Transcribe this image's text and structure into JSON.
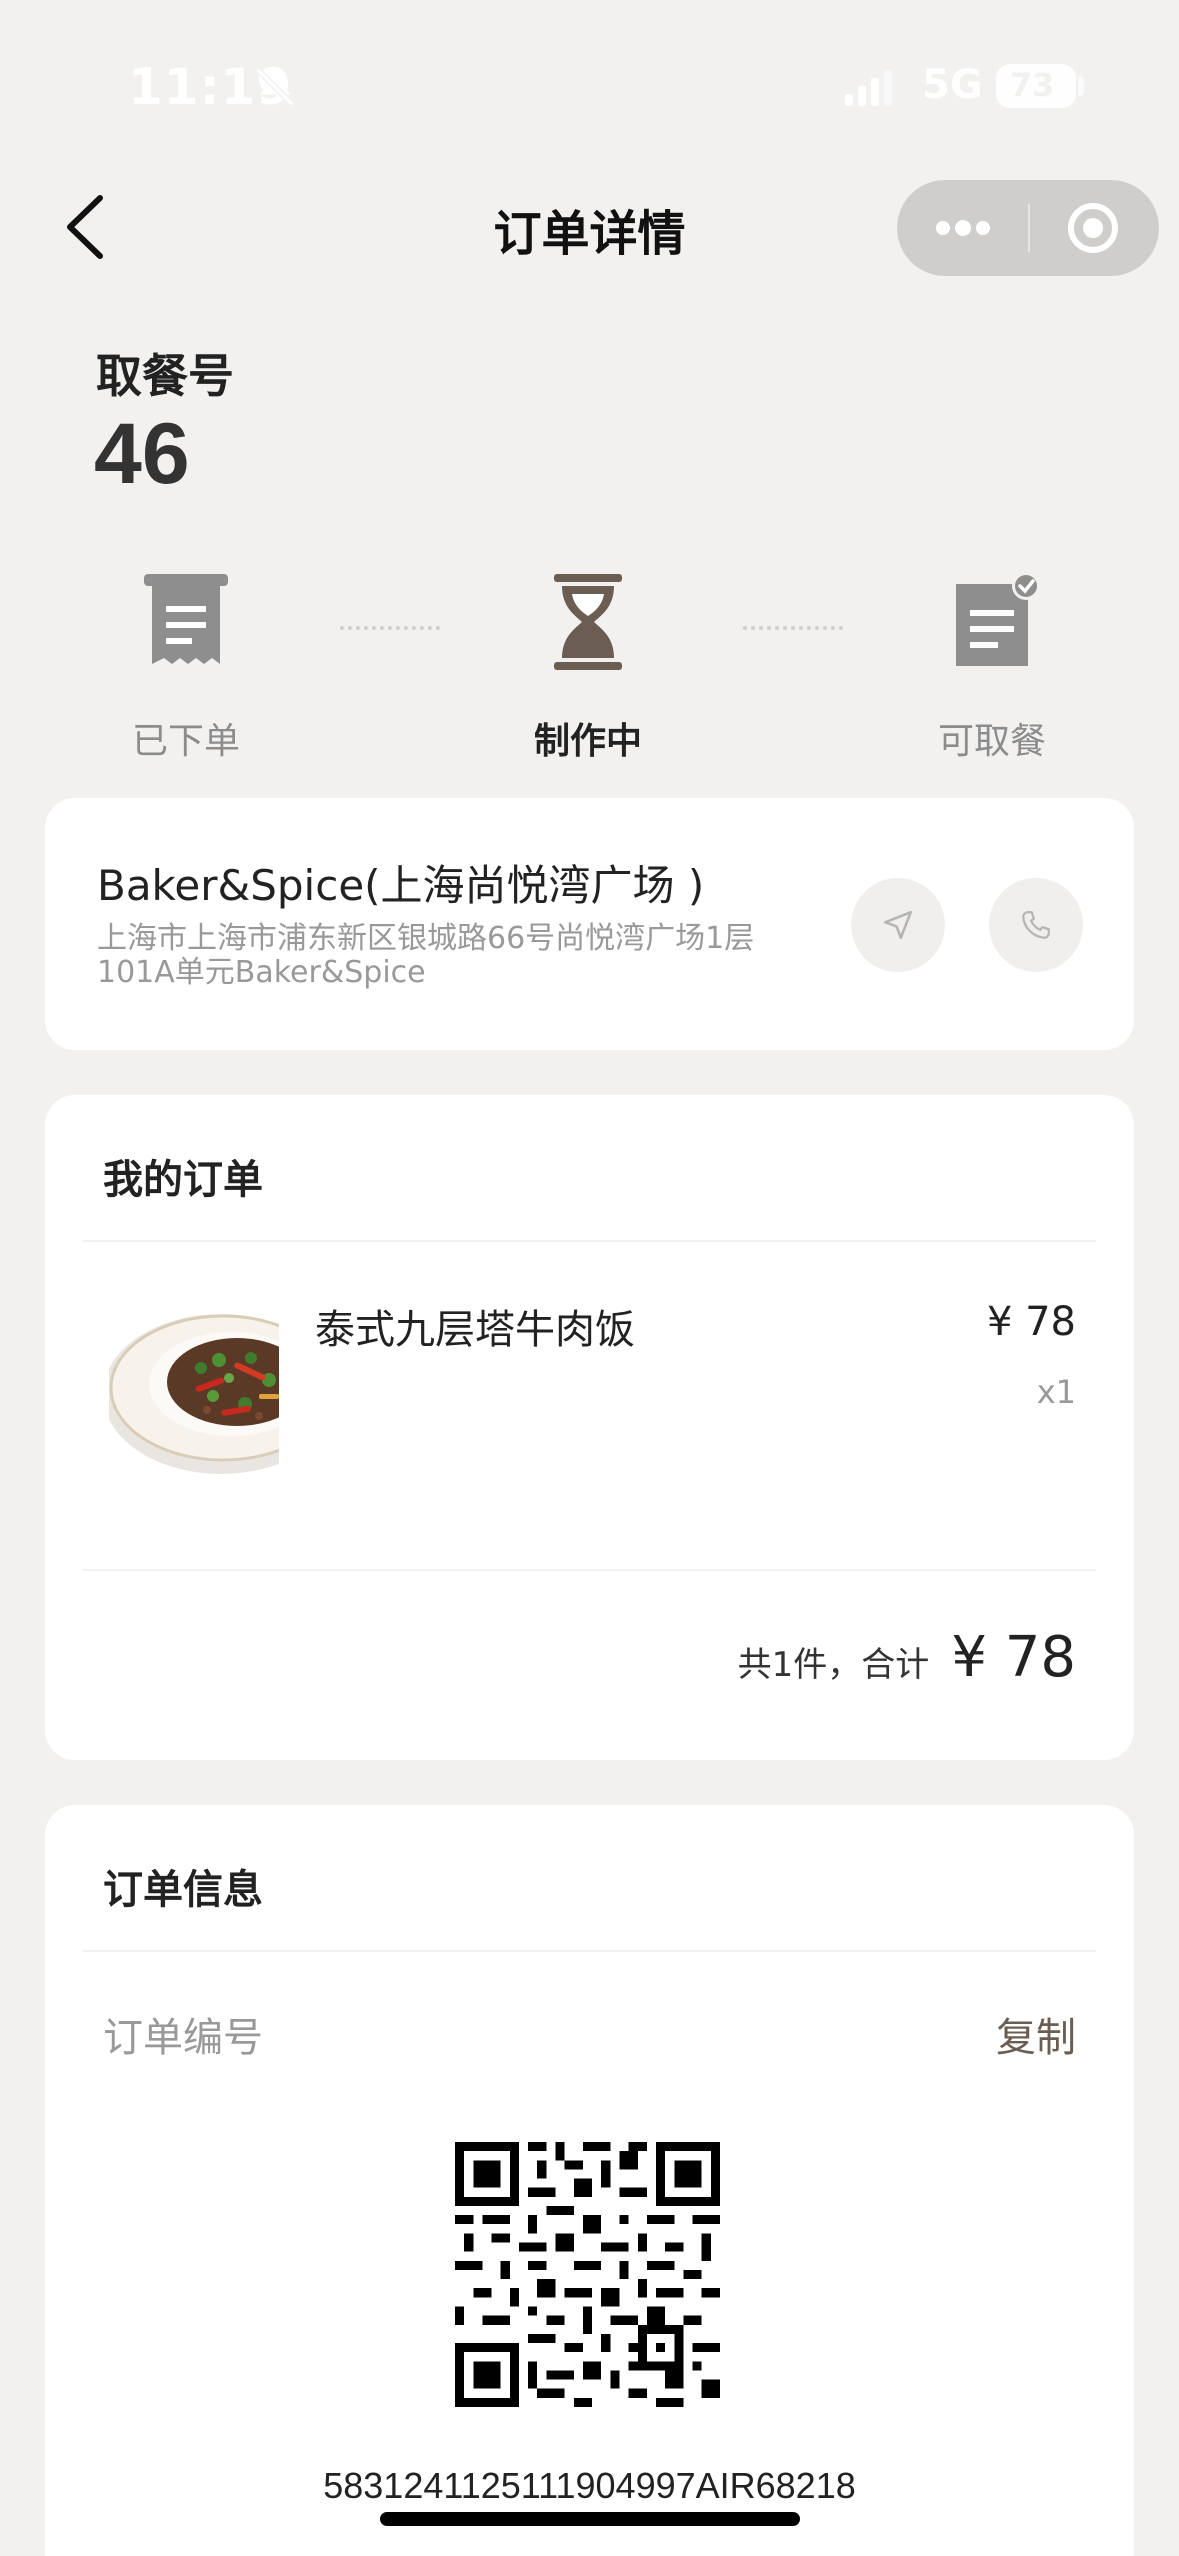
{
  "status_bar": {
    "time": "11:19",
    "network": "5G",
    "battery": "73",
    "icons": [
      "bell-slash-icon",
      "signal-icon",
      "battery-icon"
    ]
  },
  "nav": {
    "title": "订单详情",
    "back_icon": "chevron-left-icon",
    "capsule_icons": [
      "more-icon",
      "target-icon"
    ]
  },
  "pickup": {
    "label": "取餐号",
    "number": "46"
  },
  "steps": [
    {
      "label": "已下单",
      "icon": "receipt-icon",
      "active": false
    },
    {
      "label": "制作中",
      "icon": "hourglass-icon",
      "active": true
    },
    {
      "label": "可取餐",
      "icon": "clipboard-check-icon",
      "active": false
    }
  ],
  "store": {
    "name": "Baker&Spice(上海尚悦湾广场 )",
    "address": "上海市上海市浦东新区银城路66号尚悦湾广场1层101A单元Baker&Spice",
    "actions": [
      "navigate-icon",
      "phone-icon"
    ]
  },
  "order": {
    "title": "我的订单",
    "items": [
      {
        "name": "泰式九层塔牛肉饭",
        "price": "¥ 78",
        "qty": "x1"
      }
    ],
    "total_label": "共1件，合计",
    "total_amount": "¥ 78"
  },
  "info": {
    "title": "订单信息",
    "order_no_label": "订单编号",
    "copy_label": "复制",
    "order_no": "5831241125111904997AIR68218"
  },
  "colors": {
    "background": "#f2f1f0",
    "brand_brown": "#6b5d51",
    "active_icon": "#6b5d51",
    "inactive_icon": "#8e8e8e"
  }
}
